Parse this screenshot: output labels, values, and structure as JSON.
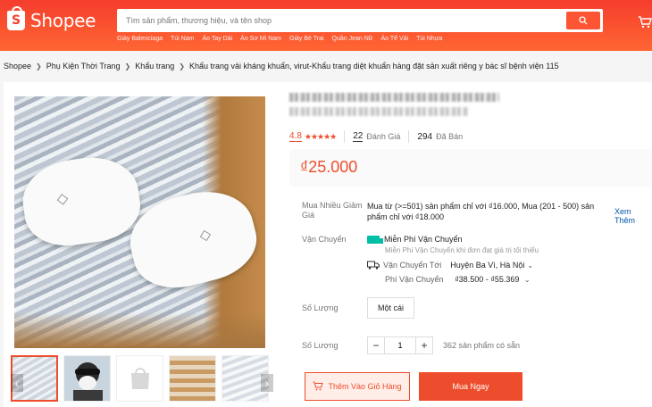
{
  "header": {
    "logo_text": "Shopee",
    "logo_glyph": "S",
    "search_placeholder": "Tìm sản phẩm, thương hiệu, và tên shop",
    "suggestions": [
      "Giày Balenciaga",
      "Túi Nam",
      "Áo Tay Dài",
      "Áo Sơ Mi Nam",
      "Giày Bé Trai",
      "Quần Jean Nữ",
      "Áo Tể Vải",
      "Túi Nhựa"
    ],
    "icons": {
      "search": "search-icon",
      "cart": "cart-icon"
    },
    "colors": {
      "brand": "#ee4d2d"
    }
  },
  "breadcrumb": [
    "Shopee",
    "Phụ Kiện Thời Trang",
    "Khẩu trang",
    "Khẩu trang vải kháng khuẩn, virut-Khẩu trang diệt khuẩn hàng đặt sản xuất riêng y bác sĩ bệnh viện 115"
  ],
  "product": {
    "rating": "4.8",
    "stars": "★★★★★",
    "review_count": "22",
    "review_label": "Đánh Giá",
    "sold_count": "294",
    "sold_label": "Đã Bán",
    "price": "₫25.000",
    "bulk": {
      "label": "Mua Nhiều Giảm Giá",
      "text": "Mua từ (>=501) sản phẩm chỉ với ₫16.000, Mua (201 - 500) sản phẩm chỉ với ₫18.000",
      "see_more": "Xem Thêm"
    },
    "shipping": {
      "label": "Vận Chuyển",
      "free": "Miễn Phí Vận Chuyển",
      "free_sub": "Miễn Phí Vận Chuyển khi đơn đạt giá trị tối thiểu",
      "to_label": "Vận Chuyển Tới",
      "to_value": "Huyện Ba Vì, Hà Nội",
      "fee_label": "Phí Vận Chuyển",
      "fee_value": "₫38.500 - ₫55.369"
    },
    "variant": {
      "label": "Số Lượng",
      "option": "Một cái"
    },
    "quantity": {
      "label": "Số Lượng",
      "value": "1",
      "minus": "−",
      "plus": "+",
      "stock": "362 sản phẩm có sẵn"
    },
    "actions": {
      "add_to_cart": "Thêm Vào Giỏ Hàng",
      "buy_now": "Mua Ngay"
    },
    "thumb_arrows": {
      "left": "‹",
      "right": "›"
    }
  }
}
